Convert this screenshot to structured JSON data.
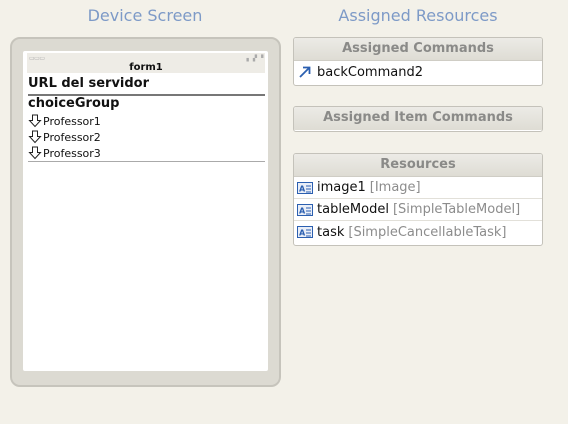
{
  "headings": {
    "device": "Device Screen",
    "assigned": "Assigned Resources"
  },
  "device": {
    "form_title": "form1",
    "url_label": "URL del servidor",
    "choice_group_label": "choiceGroup",
    "choices": [
      "Professor1",
      "Professor2",
      "Professor3"
    ]
  },
  "assigned_commands": {
    "header": "Assigned Commands",
    "items": [
      {
        "name": "backCommand2",
        "icon": "command-arrow-icon"
      }
    ]
  },
  "assigned_item_commands": {
    "header": "Assigned Item Commands"
  },
  "resources": {
    "header": "Resources",
    "items": [
      {
        "name": "image1",
        "type": "[Image]",
        "icon": "resource-icon"
      },
      {
        "name": "tableModel",
        "type": "[SimpleTableModel]",
        "icon": "resource-icon"
      },
      {
        "name": "task",
        "type": "[SimpleCancellableTask]",
        "icon": "resource-icon"
      }
    ]
  },
  "colors": {
    "heading": "#7d9ac7",
    "background": "#f3f1e9",
    "panel_header_text": "#8a8a88",
    "type_text": "#8c8c8c"
  }
}
